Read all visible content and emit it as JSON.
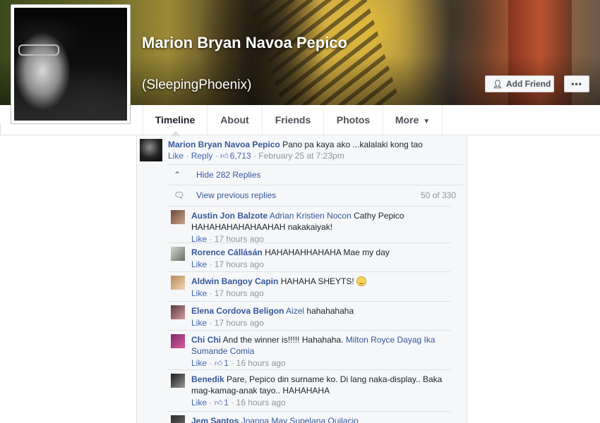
{
  "profile": {
    "name": "Marion Bryan Navoa Pepico",
    "alternate_name": "(SleepingPhoenix)",
    "add_friend_label": "Add Friend",
    "more_actions_label": "•••"
  },
  "nav": {
    "tabs": [
      {
        "label": "Timeline",
        "active": true
      },
      {
        "label": "About"
      },
      {
        "label": "Friends"
      },
      {
        "label": "Photos"
      },
      {
        "label": "More"
      }
    ]
  },
  "comment": {
    "author": "Marion Bryan Navoa Pepico",
    "text": "Pano pa kaya ako ...kalalaki kong tao",
    "like_label": "Like",
    "reply_label": "Reply",
    "likes": "6,713",
    "timestamp": "February 25 at 7:23pm",
    "hide_replies": "Hide 282 Replies",
    "view_previous": "View previous replies",
    "range": "50 of 330"
  },
  "replies": [
    {
      "author": "Austin Jon Balzote",
      "mention": "Adrian Kristien Nocon",
      "text": "Cathy Pepico HAHAHAHAHAHAAHAH nakakaiyak!",
      "like_label": "Like",
      "likes": "",
      "time": "17 hours ago"
    },
    {
      "author": "Rorence Cállásán",
      "mention": "",
      "text": "HAHAHAHHAHAHA Mae my day",
      "like_label": "Like",
      "likes": "",
      "time": "17 hours ago"
    },
    {
      "author": "Aldwin Bangoy Capin",
      "mention": "",
      "text": "HAHAHA SHEYTS!",
      "like_label": "Like",
      "likes": "",
      "time": "17 hours ago",
      "emoji": "smile"
    },
    {
      "author": "Elena Cordova Beligon",
      "mention": "Aizel",
      "text": "hahahahaha",
      "like_label": "Like",
      "likes": "",
      "time": "17 hours ago"
    },
    {
      "author": "Chi Chi",
      "mention": "",
      "text": "And the winner is!!!!! Hahahaha.",
      "mention_after": "Milton Royce Dayag Ika Sumande Comia",
      "like_label": "Like",
      "likes": "1",
      "time": "16 hours ago"
    },
    {
      "author": "Benedik",
      "mention": "",
      "text": "Pare, Pepico din surname ko. Di lang naka-display.. Baka mag-kamag-anak tayo.. HAHAHAHA",
      "like_label": "Like",
      "likes": "1",
      "time": "16 hours ago"
    },
    {
      "author": "Jem Santos",
      "mention": "Joanna May Supelana Quilacio",
      "text": "",
      "like_label": "",
      "likes": "",
      "time": ""
    }
  ],
  "colors": {
    "link": "#365899",
    "meta": "#90949c",
    "panel_bg": "#f6f7f9",
    "border": "#dddfe2"
  }
}
